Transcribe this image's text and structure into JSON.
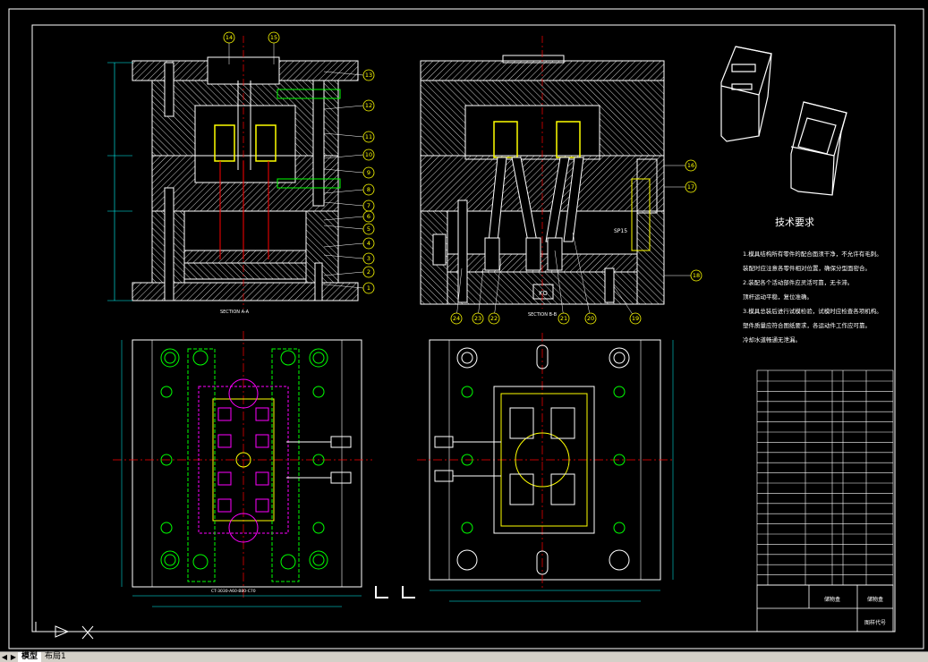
{
  "drawing": {
    "tech_title": "技术要求",
    "tech_lines": [
      "1.模具结构所有零件的配合面须干净，不允许有毛刺。",
      "装配时应注意各零件相对位置，确保分型面密合。",
      "2.装配各个活动部件应灵活可靠，无卡滞。",
      "顶杆运动平稳，复位准确。",
      "3.模具总装后进行试模检验，试模时应检查各项机构。",
      "塑件质量应符合图纸要求，各运动件工作应可靠。",
      "冷却水道畅通无泄漏。"
    ],
    "section_labels": {
      "left": "SECTION A-A",
      "right": "SECTION B-B"
    },
    "balloons_left": [
      "14",
      "15",
      "13",
      "12",
      "11",
      "10",
      "9",
      "8",
      "7",
      "6",
      "5",
      "4",
      "3",
      "2",
      "1"
    ],
    "balloons_right": [
      "16",
      "17",
      "18",
      "19",
      "20",
      "21",
      "22",
      "23",
      "24"
    ],
    "title_block": {
      "name": "储物盒",
      "drawing_no": "图样代号"
    },
    "spare_label": "SP15"
  },
  "tabs": {
    "nav_first": "◀",
    "nav_last": "▶",
    "model": "模型",
    "layout": "布局1"
  },
  "colors": {
    "background": "#000000",
    "outline": "#ffffff",
    "hatch": "#ffffff",
    "center_line": "#ff0000",
    "part": "#ffff00",
    "cooling": "#00ff00",
    "dimension": "#00ffff",
    "circle": "#ff00ff"
  }
}
